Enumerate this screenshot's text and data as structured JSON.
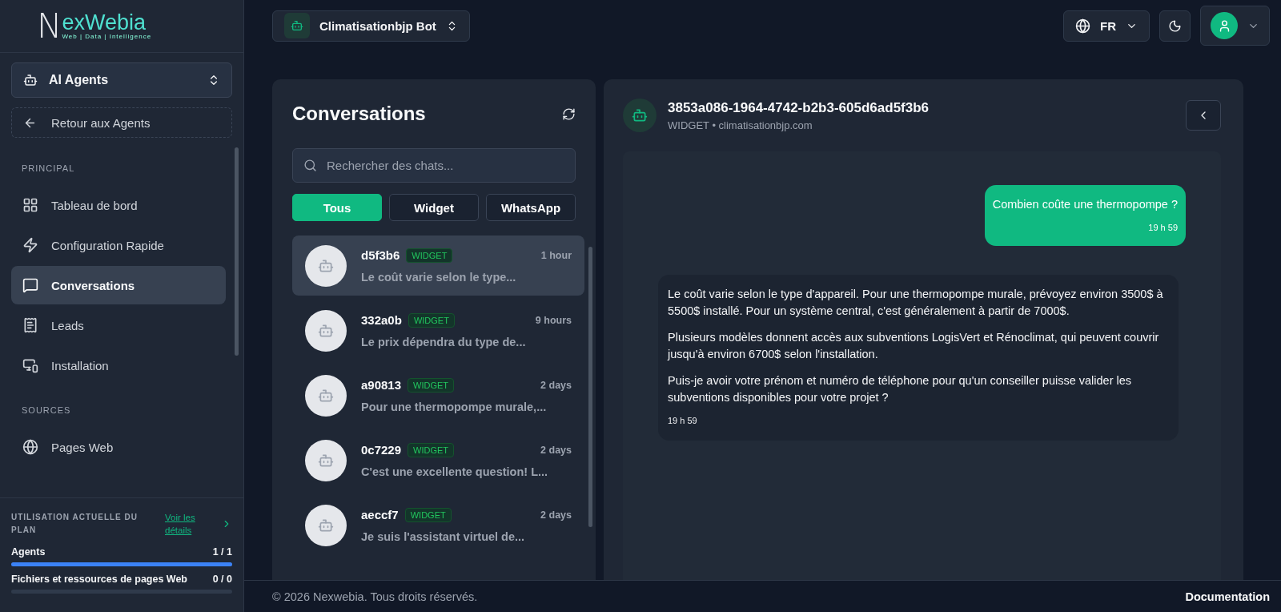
{
  "logo": {
    "mark": "N",
    "name": "exWebia",
    "tagline": "Web | Data | Intelligence"
  },
  "agent_switcher": {
    "label": "AI Agents"
  },
  "back_button": {
    "label": "Retour aux Agents"
  },
  "nav_sections": [
    {
      "title": "PRINCIPAL",
      "items": [
        {
          "kind": "dashboard",
          "label": "Tableau de bord",
          "selected": false
        },
        {
          "kind": "quick",
          "label": "Configuration Rapide",
          "selected": false
        },
        {
          "kind": "chat",
          "label": "Conversations",
          "selected": true
        },
        {
          "kind": "leads",
          "label": "Leads",
          "selected": false
        },
        {
          "kind": "install",
          "label": "Installation",
          "selected": false
        }
      ]
    },
    {
      "title": "SOURCES",
      "items": [
        {
          "kind": "web",
          "label": "Pages Web",
          "selected": false
        }
      ]
    }
  ],
  "plan_usage": {
    "title": "UTILISATION ACTUELLE DU PLAN",
    "link": "Voir les détails",
    "meters": [
      {
        "label": "Agents",
        "reading": "1 / 1",
        "level": 1
      },
      {
        "label": "Fichiers et ressources de pages Web",
        "reading": "0 / 0"
      }
    ]
  },
  "bot_selector": {
    "label": "Climatisationbjp Bot"
  },
  "language": {
    "label": "FR"
  },
  "conversations": {
    "title": "Conversations",
    "search": {
      "placeholder": "Rechercher des chats..."
    },
    "filters": [
      {
        "label": "Tous",
        "selected": true
      },
      {
        "label": "Widget",
        "selected": false
      },
      {
        "label": "WhatsApp",
        "selected": false
      }
    ],
    "items": [
      {
        "id": "d5f3b6",
        "badge": "WIDGET",
        "time": "1 hour",
        "preview": "Le coût varie selon le type...",
        "selected": true
      },
      {
        "id": "332a0b",
        "badge": "WIDGET",
        "time": "9 hours",
        "preview": "Le prix dépendra du type de...",
        "selected": false
      },
      {
        "id": "a90813",
        "badge": "WIDGET",
        "time": "2 days",
        "preview": "Pour une thermopompe murale,...",
        "selected": false
      },
      {
        "id": "0c7229",
        "badge": "WIDGET",
        "time": "2 days",
        "preview": "C'est une excellente question! L...",
        "selected": false
      },
      {
        "id": "aeccf7",
        "badge": "WIDGET",
        "time": "2 days",
        "preview": "Je suis l'assistant virtuel de...",
        "selected": false
      }
    ]
  },
  "chat": {
    "title": "3853a086-1964-4742-b2b3-605d6ad5f3b6",
    "channel": "WIDGET",
    "separator": "•",
    "source": "climatisationbjp.com",
    "messages": [
      {
        "kind": "user",
        "paragraphs": [
          "Combien coûte une thermopompe ?"
        ],
        "time": "19 h 59"
      },
      {
        "kind": "bot",
        "paragraphs": [
          "Le coût varie selon le type d'appareil. Pour une thermopompe murale, prévoyez environ 3500$ à 5500$ installé. Pour un système central, c'est généralement à partir de 7000$.",
          "Plusieurs modèles donnent accès aux subventions LogisVert et Rénoclimat, qui peuvent couvrir jusqu'à environ 6700$ selon l'installation.",
          "Puis-je avoir votre prénom et numéro de téléphone pour qu'un conseiller puisse valider les subventions disponibles pour votre projet ?"
        ],
        "time": "19 h 59"
      }
    ]
  },
  "footer": {
    "copyright": "© 2026 Nexwebia. Tous droits réservés.",
    "link": "Documentation"
  }
}
